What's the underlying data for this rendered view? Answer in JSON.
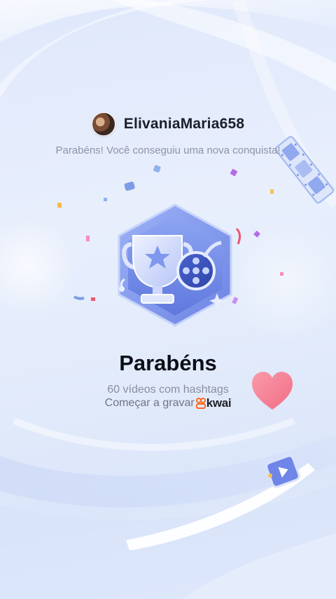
{
  "header": {
    "username": "ElivaniaMaria658"
  },
  "message": {
    "congrats": "Parabéns! Você conseguiu uma nova conquista!"
  },
  "achievement": {
    "title": "Parabéns",
    "description": "60 vídeos com hashtags",
    "cta": "Começar a gravar",
    "brand": "kwai"
  },
  "icons": {
    "badge": "trophy-film-badge-icon",
    "heart": "heart-icon",
    "film": "film-strip-icon",
    "play": "play-cube-icon",
    "logo": "kwai-logo-icon"
  },
  "colors": {
    "accent": "#6f86e8",
    "heart": "#f57f95",
    "kwai_orange": "#ff6a1f"
  }
}
